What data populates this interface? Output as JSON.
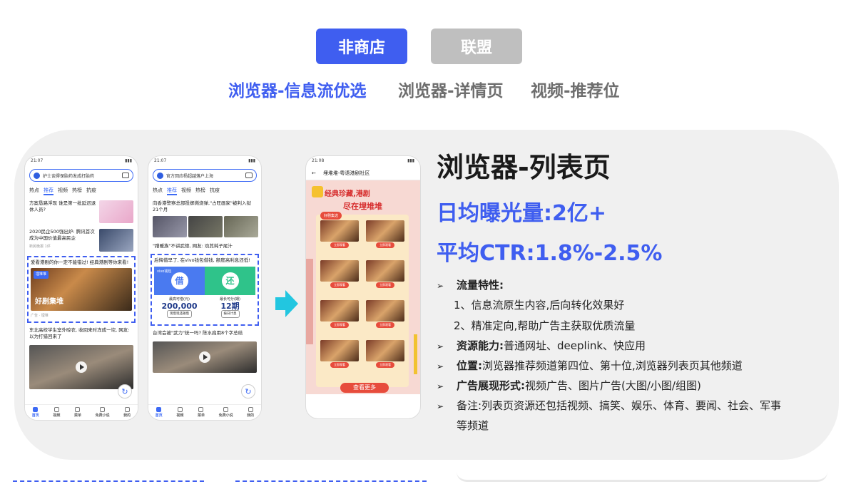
{
  "top_tabs": {
    "nonstore": "非商店",
    "alliance": "联盟"
  },
  "sub_tabs": {
    "feed": "浏览器-信息流优选",
    "detail": "浏览器-详情页",
    "video": "视频-推荐位"
  },
  "phone1": {
    "status": "21:07",
    "search": "护士谈得保胎药发成打胎药",
    "tabs": [
      "热点",
      "推荐",
      "视频",
      "热榜",
      "抗疫"
    ],
    "news": [
      {
        "title": "方案恳路浮现 谁是第一批延迟退休人员?"
      },
      {
        "title": "2020民企500强出炉: 腾讯首次成为中国价值最高民企",
        "meta": "新民晚报 1评"
      }
    ],
    "ad_title": "爱看港剧的你一定不能错过! 经典港剧等你来看!",
    "ad_badge": "埋堆堆",
    "ad_caption": "好剧集堆",
    "ad_meta": "广告 · 埋堆",
    "news2": "东北高校学生室外晾衣, 收回来时冻成一坨, 网友: 以为打猎回来了",
    "nav": [
      "首页",
      "视频",
      "菜单",
      "免费小说",
      "我的"
    ]
  },
  "phone2": {
    "status": "21:07",
    "search": "官方回应杨超越落户上海",
    "tabs": [
      "热点",
      "推荐",
      "视频",
      "热榜",
      "抗疫"
    ],
    "news1": "向香港警察总部投掷燃烧弹,\"占旺画家\"被判入狱21个月",
    "news2": "\"蹭暖族\"不讲武德, 网友: 劝其耗子尾汁",
    "ad_title": "后悔借早了, 在vivo钱包借钱, 额度高利息还低!",
    "wallet_brand": "vivo钱包",
    "borrow": "借",
    "repay": "还",
    "borrow_label": "最高可借(元)",
    "borrow_amount": "200,000",
    "borrow_btn": "现借现还随借",
    "repay_label": "最长可分(期)",
    "repay_amount": "12期",
    "repay_btn": "按日计息",
    "news3": "台湾会被\"武力\"统一吗? 陈水扁用8个字总结",
    "nav": [
      "首页",
      "视频",
      "菜单",
      "免费小说",
      "我的"
    ]
  },
  "phone3": {
    "status": "21:08",
    "header": "埋堆堆-粤语港剧社区",
    "banner1": "经典珍藏,港剧",
    "banner2": "尽在埋堆堆",
    "pill": "好剧集选",
    "btn": "立即观看",
    "more": "查看更多"
  },
  "detail": {
    "title": "浏览器-列表页",
    "exposure": "日均曝光量:2亿+",
    "ctr": "平均CTR:1.8%-2.5%",
    "b1_label": "流量特性:",
    "b1_sub1": "1、信息流原生内容,后向转化效果好",
    "b1_sub2": "2、精准定向,帮助广告主获取优质流量",
    "b2_label": "资源能力:",
    "b2_text": "普通网址、deeplink、快应用",
    "b3_label": "位置:",
    "b3_text": "浏览器推荐频道第四位、第十位,浏览器列表页其他频道",
    "b4_label": "广告展现形式:",
    "b4_text": "视频广告、图片广告(大图/小图/组图)",
    "b5_text": "备注:列表页资源还包括视频、搞笑、娱乐、体育、要闻、社会、军事",
    "b5_cont": "等频道"
  }
}
